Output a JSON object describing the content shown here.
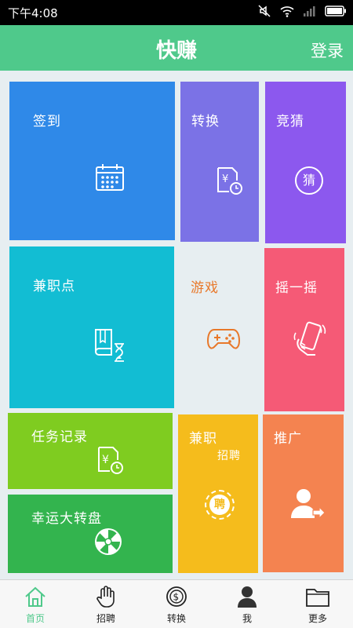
{
  "status_bar": {
    "time": "下午4:08"
  },
  "header": {
    "title": "快赚",
    "login_label": "登录"
  },
  "tiles": {
    "sign_in": {
      "label": "签到",
      "icon": "calendar-icon"
    },
    "convert": {
      "label": "转换",
      "icon": "yuan-document-clock-icon"
    },
    "guess": {
      "label": "竞猜",
      "icon": "guess-circle-icon",
      "icon_text": "猜"
    },
    "part_time_points": {
      "label": "兼职点",
      "icon": "book-hourglass-icon"
    },
    "game": {
      "label": "游戏",
      "icon": "gamepad-icon"
    },
    "shake": {
      "label": "摇一摇",
      "icon": "shake-phone-icon"
    },
    "task_records": {
      "label": "任务记录",
      "icon": "yuan-document-clock-icon"
    },
    "lucky_wheel": {
      "label": "幸运大转盘",
      "icon": "wheel-icon"
    },
    "part_time": {
      "label": "兼职",
      "sub_label": "招聘",
      "icon": "recruit-badge-icon",
      "icon_text": "聘"
    },
    "promotion": {
      "label": "推广",
      "icon": "user-share-icon"
    }
  },
  "tab_bar": {
    "items": [
      {
        "label": "首页",
        "icon": "home-icon",
        "active": true
      },
      {
        "label": "招聘",
        "icon": "hand-icon",
        "active": false
      },
      {
        "label": "转换",
        "icon": "coin-icon",
        "active": false
      },
      {
        "label": "我",
        "icon": "person-icon",
        "active": false
      },
      {
        "label": "更多",
        "icon": "folder-icon",
        "active": false
      }
    ]
  },
  "colors": {
    "header": "#4fc98b",
    "sign_in": "#2f89e8",
    "convert": "#7b72e6",
    "guess": "#8c58ee",
    "part_time_points": "#12bdd3",
    "game_text": "#e8782a",
    "shake": "#f55a76",
    "task_records": "#7fcc20",
    "lucky_wheel": "#33b44e",
    "part_time": "#f5bc1c",
    "promotion": "#f48350",
    "tab_active": "#4fc98b"
  }
}
